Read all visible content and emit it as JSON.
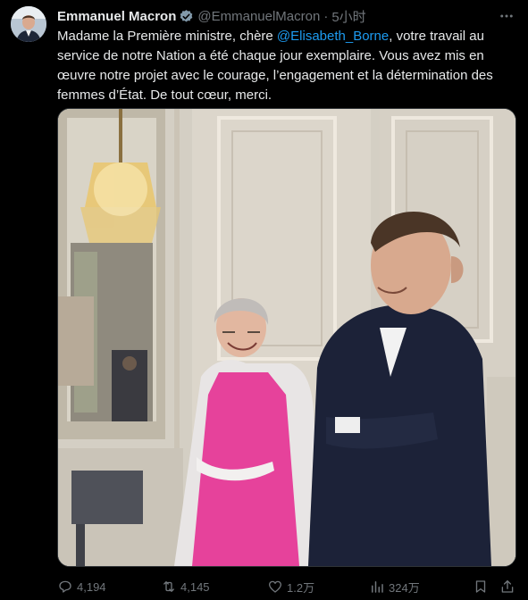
{
  "author": {
    "name": "Emmanuel Macron",
    "handle": "@EmmanuelMacron",
    "separator": "·",
    "time": "5小时"
  },
  "tweet": {
    "text_before": "Madame la Première ministre, chère ",
    "mention": "@Elisabeth_Borne",
    "text_after": ", votre travail au service de notre Nation a été chaque jour exemplaire. Vous avez mis en œuvre notre projet avec le courage, l’engagement et la détermination des femmes d’État. De tout cœur, merci."
  },
  "actions": {
    "replies": "4,194",
    "reposts": "4,145",
    "likes": "1.2万",
    "views": "324万"
  },
  "icons": {
    "verified": "verified-badge-icon",
    "more": "more-icon",
    "reply": "reply-icon",
    "repost": "repost-icon",
    "like": "heart-icon",
    "views": "views-icon",
    "bookmark": "bookmark-icon",
    "share": "share-icon"
  },
  "colors": {
    "background": "#000000",
    "text": "#e7e9ea",
    "secondary": "#71767b",
    "accent": "#1d9bf0"
  }
}
